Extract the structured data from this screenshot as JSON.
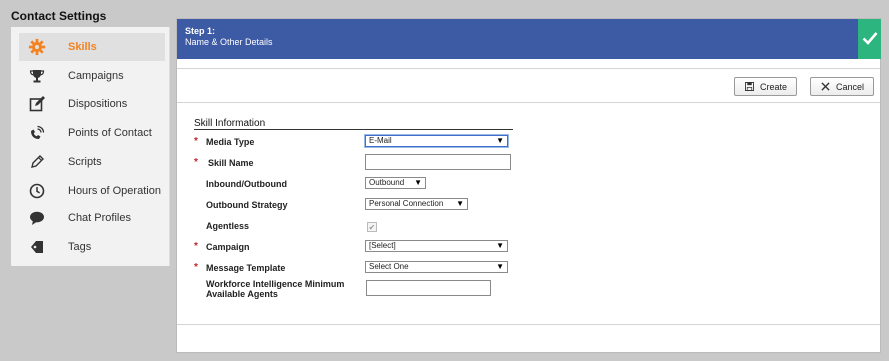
{
  "sidebar": {
    "title": "Contact Settings",
    "items": [
      {
        "label": "Skills",
        "icon": "gear-icon",
        "active": true
      },
      {
        "label": "Campaigns",
        "icon": "trophy-icon",
        "active": false
      },
      {
        "label": "Dispositions",
        "icon": "edit-icon",
        "active": false
      },
      {
        "label": "Points of Contact",
        "icon": "phone-wifi-icon",
        "active": false
      },
      {
        "label": "Scripts",
        "icon": "pencil-icon",
        "active": false
      },
      {
        "label": "Hours of Operation",
        "icon": "clock-icon",
        "active": false
      },
      {
        "label": "Chat Profiles",
        "icon": "chat-bubble-icon",
        "active": false
      },
      {
        "label": "Tags",
        "icon": "tag-icon",
        "active": false
      }
    ]
  },
  "step": {
    "title": "Step 1:",
    "subtitle": "Name & Other Details"
  },
  "toolbar": {
    "create_label": "Create",
    "cancel_label": "Cancel"
  },
  "form": {
    "section_title": "Skill Information",
    "media_type": {
      "label": "Media Type",
      "value": "E-Mail"
    },
    "skill_name": {
      "label": "Skill Name",
      "value": ""
    },
    "inbound_outbound": {
      "label": "Inbound/Outbound",
      "value": "Outbound"
    },
    "outbound_strategy": {
      "label": "Outbound Strategy",
      "value": "Personal Connection"
    },
    "agentless": {
      "label": "Agentless",
      "checked": true
    },
    "campaign": {
      "label": "Campaign",
      "value": "[Select]"
    },
    "message_template": {
      "label": "Message Template",
      "value": "Select One"
    },
    "wfi_min_agents": {
      "label_line1": "Workforce Intelligence Minimum",
      "label_line2": "Available Agents",
      "value": ""
    }
  },
  "colors": {
    "accent": "#f58220",
    "step_bar": "#3d5aa5",
    "complete": "#2db580",
    "required": "#c0282d"
  }
}
